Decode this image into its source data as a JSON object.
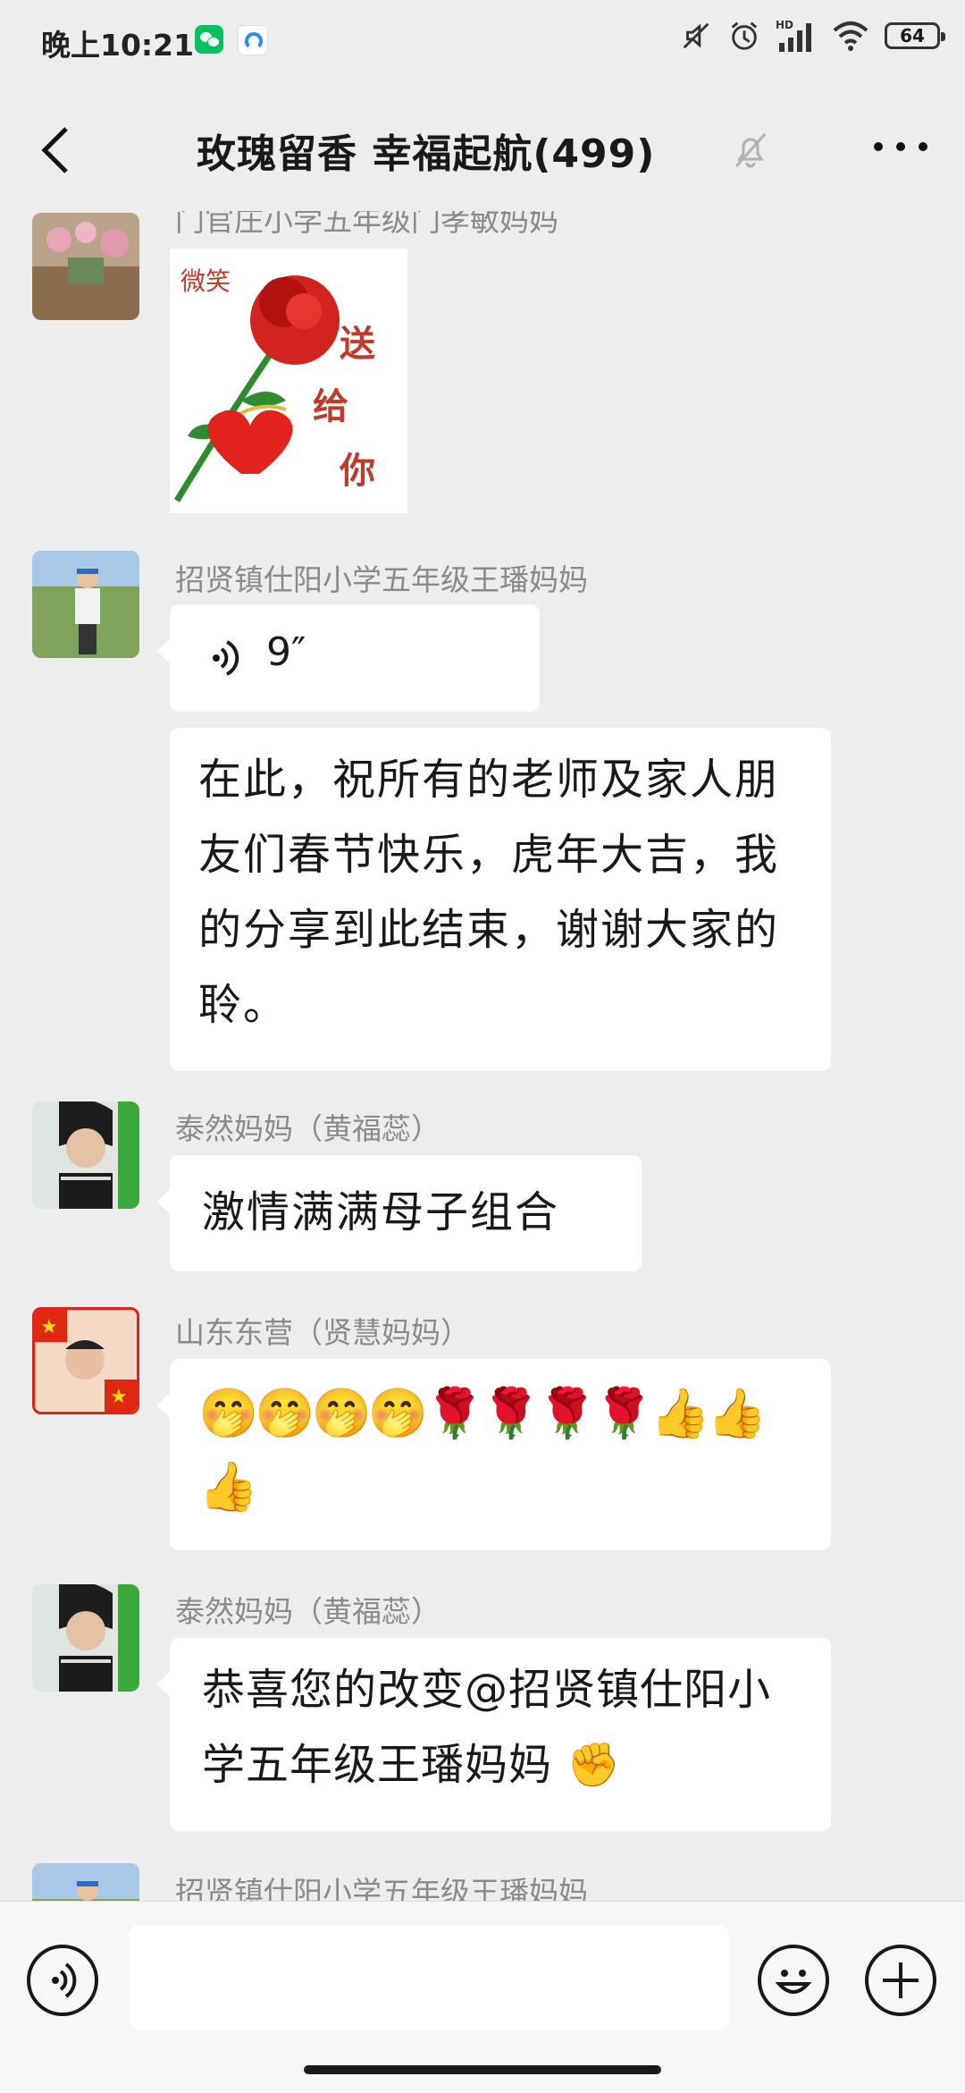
{
  "status_bar": {
    "time": "晚上10:21",
    "battery": "64",
    "icons": [
      "wechat-icon",
      "app-icon",
      "mute-icon",
      "alarm-icon",
      "hd-signal-icon",
      "wifi-icon",
      "battery-icon"
    ]
  },
  "header": {
    "title": "玫瑰留香  幸福起航(499)",
    "back_icon": "chevron-left-icon",
    "mute_icon": "bell-off-icon",
    "more_icon": "more-dots-icon"
  },
  "messages": [
    {
      "sender": "门官庄小学五年级门孝敏妈妈",
      "type": "image",
      "sticker_text": "微笑",
      "sticker_caption": "送给你"
    },
    {
      "sender": "招贤镇仕阳小学五年级王璠妈妈",
      "type": "voice",
      "duration": "9″"
    },
    {
      "sender": "",
      "type": "text",
      "text": "在此，祝所有的老师及家人朋友们春节快乐，虎年大吉，我的分享到此结束，谢谢大家的聆。"
    },
    {
      "sender": "泰然妈妈（黄福蕊）",
      "type": "text",
      "text": "激情满满母子组合"
    },
    {
      "sender": "山东东营（贤慧妈妈）",
      "type": "emoji",
      "text": "🤭🤭🤭🤭🌹🌹🌹🌹👍👍👍"
    },
    {
      "sender": "泰然妈妈（黄福蕊）",
      "type": "text",
      "text": "恭喜您的改变@招贤镇仕阳小学五年级王璠妈妈 ✊"
    },
    {
      "sender": "招贤镇仕阳小学五年级王璠妈妈",
      "type": "partial"
    }
  ],
  "input_bar": {
    "voice_icon": "voice-input-icon",
    "emoji_icon": "emoji-icon",
    "plus_icon": "plus-icon"
  },
  "colors": {
    "background": "#ededed",
    "bubble": "#ffffff",
    "sender_text": "#8a8a8a",
    "wechat_green": "#07c160"
  }
}
